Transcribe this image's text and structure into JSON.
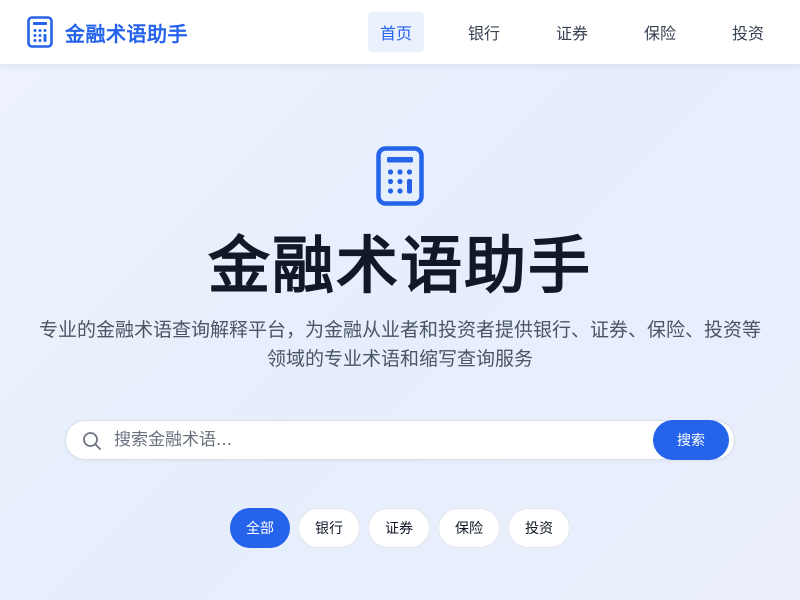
{
  "brand": {
    "name": "金融术语助手",
    "icon": "calculator-icon"
  },
  "nav": {
    "items": [
      {
        "label": "首页",
        "active": true
      },
      {
        "label": "银行",
        "active": false
      },
      {
        "label": "证券",
        "active": false
      },
      {
        "label": "保险",
        "active": false
      },
      {
        "label": "投资",
        "active": false
      }
    ]
  },
  "hero": {
    "icon": "calculator-icon",
    "title": "金融术语助手",
    "description_line1": "专业的金融术语查询解释平台，为金融从业者和投资者提供银行、证券、保险、投资等",
    "description_line2": "领域的专业术语和缩写查询服务"
  },
  "search": {
    "icon": "search-icon",
    "placeholder": "搜索金融术语...",
    "value": "",
    "button_label": "搜索"
  },
  "filters": {
    "chips": [
      {
        "label": "全部",
        "active": true
      },
      {
        "label": "银行",
        "active": false
      },
      {
        "label": "证券",
        "active": false
      },
      {
        "label": "保险",
        "active": false
      },
      {
        "label": "投资",
        "active": false
      }
    ]
  },
  "colors": {
    "accent": "#2563eb",
    "title_text": "#111827",
    "body_text": "#4b5563",
    "nav_active_bg": "#eaf1fd"
  }
}
